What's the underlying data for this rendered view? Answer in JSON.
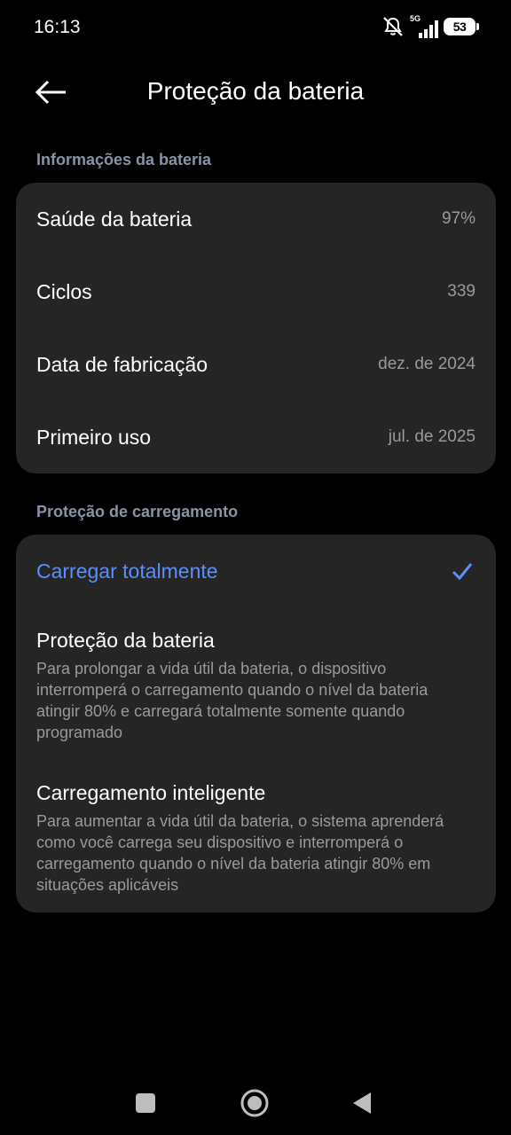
{
  "status_bar": {
    "time": "16:13",
    "network": "5G",
    "battery_level": "53"
  },
  "header": {
    "title": "Proteção da bateria"
  },
  "battery_info": {
    "section_label": "Informações da bateria",
    "items": [
      {
        "label": "Saúde da bateria",
        "value": "97%"
      },
      {
        "label": "Ciclos",
        "value": "339"
      },
      {
        "label": "Data de fabricação",
        "value": "dez. de 2024"
      },
      {
        "label": "Primeiro uso",
        "value": "jul. de 2025"
      }
    ]
  },
  "charging_protection": {
    "section_label": "Proteção de carregamento",
    "options": [
      {
        "title": "Carregar totalmente",
        "description": "",
        "selected": true
      },
      {
        "title": "Proteção da bateria",
        "description": "Para prolongar a vida útil da bateria, o dispositivo interromperá o carregamento quando o nível da bateria atingir 80% e carregará totalmente somente quando programado",
        "selected": false
      },
      {
        "title": "Carregamento inteligente",
        "description": "Para aumentar a vida útil da bateria, o sistema aprenderá como você carrega seu dispositivo e interromperá o carregamento quando o nível da bateria atingir 80% em situações aplicáveis",
        "selected": false
      }
    ]
  },
  "colors": {
    "accent": "#5b8ff9",
    "card": "#252525",
    "background": "#000000",
    "secondary_text": "#9a9a9a",
    "section_label": "#8a93a6"
  },
  "icons": {
    "back": "arrow-left-icon",
    "check": "checkmark-icon",
    "mute": "bell-off-icon",
    "signal": "signal-icon",
    "battery": "battery-icon",
    "nav_recents": "square-icon",
    "nav_home": "circle-icon",
    "nav_back": "triangle-back-icon"
  }
}
